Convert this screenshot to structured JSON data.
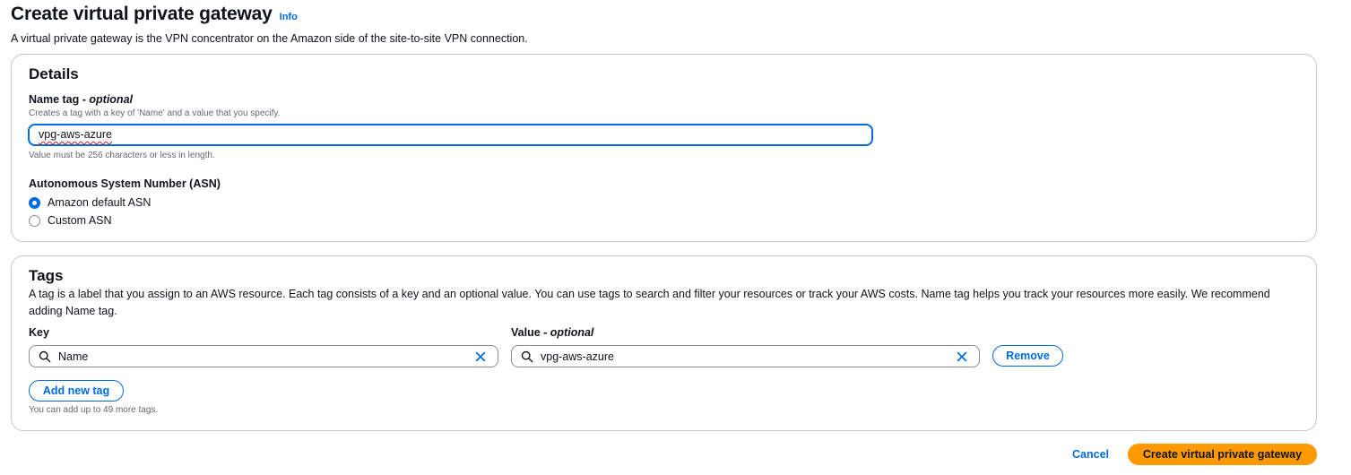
{
  "header": {
    "title": "Create virtual private gateway",
    "info_link": "Info",
    "description": "A virtual private gateway is the VPN concentrator on the Amazon side of the site-to-site VPN connection."
  },
  "details": {
    "title": "Details",
    "name_tag": {
      "label": "Name tag - ",
      "label_optional": "optional",
      "description": "Creates a tag with a key of 'Name' and a value that you specify.",
      "value": "vpg-aws-azure",
      "constraint": "Value must be 256 characters or less in length."
    },
    "asn": {
      "label": "Autonomous System Number (ASN)",
      "options": [
        {
          "label": "Amazon default ASN",
          "checked": true
        },
        {
          "label": "Custom ASN",
          "checked": false
        }
      ]
    }
  },
  "tags": {
    "title": "Tags",
    "description": "A tag is a label that you assign to an AWS resource. Each tag consists of a key and an optional value. You can use tags to search and filter your resources or track your AWS costs. Name tag helps you track your resources more easily. We recommend adding Name tag.",
    "key_label": "Key",
    "value_label": "Value - ",
    "value_label_optional": "optional",
    "rows": [
      {
        "key": "Name",
        "value": "vpg-aws-azure"
      }
    ],
    "remove_label": "Remove",
    "add_label": "Add new tag",
    "limit_note": "You can add up to 49 more tags."
  },
  "footer": {
    "cancel_label": "Cancel",
    "create_label": "Create virtual private gateway"
  },
  "colors": {
    "accent": "#006ce0",
    "primary_button": "#ff9900",
    "border": "#c6c6cd"
  },
  "icons": {
    "search": "search-icon",
    "clear": "close-icon"
  }
}
